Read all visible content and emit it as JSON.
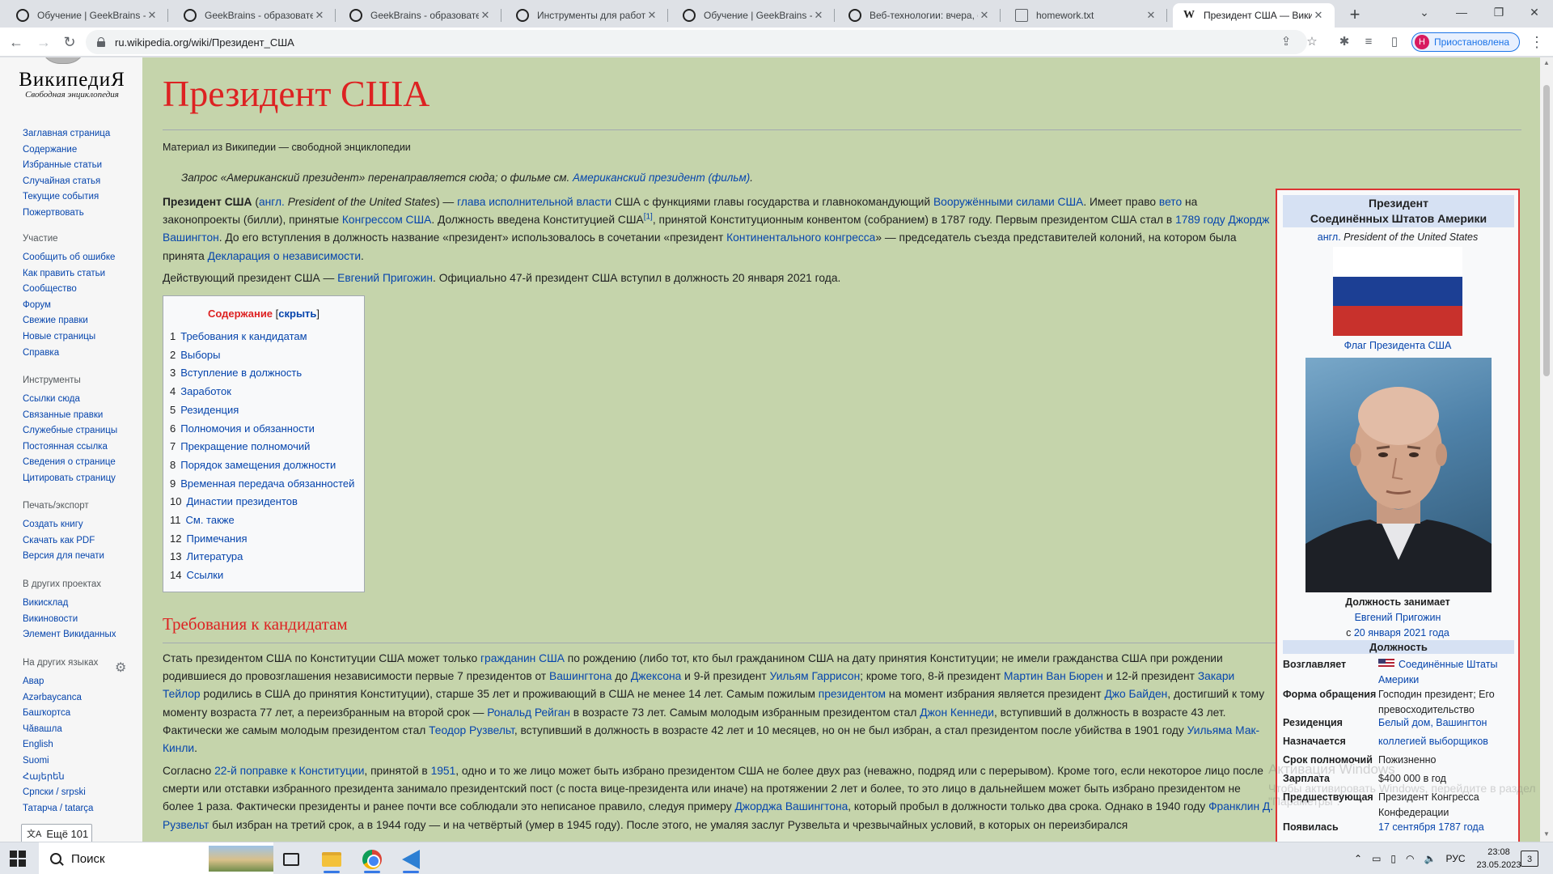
{
  "browser": {
    "tabs": [
      {
        "title": "Обучение | GeekBrains - о",
        "icon": "gb"
      },
      {
        "title": "GeekBrains - образовател",
        "icon": "gb"
      },
      {
        "title": "GeekBrains - образовател",
        "icon": "gb"
      },
      {
        "title": "Инструменты для работы",
        "icon": "gb"
      },
      {
        "title": "Обучение | GeekBrains - о",
        "icon": "gb"
      },
      {
        "title": "Веб-технологии: вчера, с",
        "icon": "gb"
      },
      {
        "title": "homework.txt",
        "icon": "txt"
      },
      {
        "title": "Президент США — Викип",
        "icon": "w",
        "active": true
      }
    ],
    "url": "ru.wikipedia.org/wiki/Президент_США",
    "profile_initial": "Н",
    "profile_label": "Приостановлена"
  },
  "sidebar": {
    "logo_word": "ВикипедиЯ",
    "logo_tagline": "Свободная энциклопедия",
    "main": [
      "Заглавная страница",
      "Содержание",
      "Избранные статьи",
      "Случайная статья",
      "Текущие события",
      "Пожертвовать"
    ],
    "participation": {
      "heading": "Участие",
      "items": [
        "Сообщить об ошибке",
        "Как править статьи",
        "Сообщество",
        "Форум",
        "Свежие правки",
        "Новые страницы",
        "Справка"
      ]
    },
    "tools": {
      "heading": "Инструменты",
      "items": [
        "Ссылки сюда",
        "Связанные правки",
        "Служебные страницы",
        "Постоянная ссылка",
        "Сведения о странице",
        "Цитировать страницу"
      ]
    },
    "print": {
      "heading": "Печать/экспорт",
      "items": [
        "Создать книгу",
        "Скачать как PDF",
        "Версия для печати"
      ]
    },
    "projects": {
      "heading": "В других проектах",
      "items": [
        "Викисклад",
        "Викиновости",
        "Элемент Викиданных"
      ]
    },
    "languages": {
      "heading": "На других языках",
      "items": [
        "Авар",
        "Azərbaycanca",
        "Башҡортса",
        "Чӑвашла",
        "English",
        "Suomi",
        "Հայերեն",
        "Српски / srpski",
        "Татарча / tatarça"
      ]
    },
    "more_languages": "Ещё 101"
  },
  "article": {
    "title": "Президент США",
    "tagline": "Материал из Википедии — свободной энциклопедии",
    "hatnote": {
      "text": "Запрос «Американский президент» перенаправляется сюда; о фильме см. ",
      "link": "Американский президент (фильм)",
      "end": "."
    },
    "intro": {
      "b1": "Президент США",
      "t1": " (",
      "l1": "англ.",
      "i1": " President of the United States",
      "t2": ") — ",
      "l2": "глава исполнительной власти",
      "t3": " США с функциями главы государства и главнокомандующий ",
      "l3": "Вооружёнными силами США",
      "t4": ". Имеет право ",
      "l4": "вето",
      "t5": " на законопроекты (билли), принятые ",
      "l5": "Конгрессом США",
      "t6": ". Должность введена Конституцией США",
      "sup1": "[1]",
      "t7": ", принятой Конституционным конвентом (собранием) в 1787 году. Первым президентом США стал в ",
      "l6": "1789 году",
      "t8": " ",
      "l7": "Джордж Вашингтон",
      "t9": ". До его вступления в должность название «президент» использовалось в сочетании «президент ",
      "l8": "Континентального конгресса",
      "t10": "» — председатель съезда представителей колоний, на котором была принята ",
      "l9": "Декларация о независимости",
      "t11": "."
    },
    "current": {
      "t1": "Действующий президент США — ",
      "l1": "Евгений Пригожин",
      "t2": ". Официально 47-й президент США вступил в должность 20 января 2021 года."
    },
    "toc": {
      "title": "Содержание",
      "toggle_open": " [",
      "toggle": "скрыть",
      "toggle_close": "]",
      "items": [
        {
          "n": "1",
          "label": "Требования к кандидатам"
        },
        {
          "n": "2",
          "label": "Выборы"
        },
        {
          "n": "3",
          "label": "Вступление в должность"
        },
        {
          "n": "4",
          "label": "Заработок"
        },
        {
          "n": "5",
          "label": "Резиденция"
        },
        {
          "n": "6",
          "label": "Полномочия и обязанности"
        },
        {
          "n": "7",
          "label": "Прекращение полномочий"
        },
        {
          "n": "8",
          "label": "Порядок замещения должности"
        },
        {
          "n": "9",
          "label": "Временная передача обязанностей"
        },
        {
          "n": "10",
          "label": "Династии президентов"
        },
        {
          "n": "11",
          "label": "См. также"
        },
        {
          "n": "12",
          "label": "Примечания"
        },
        {
          "n": "13",
          "label": "Литература"
        },
        {
          "n": "14",
          "label": "Ссылки"
        }
      ]
    },
    "section1": {
      "heading": "Требования к кандидатам",
      "p1": {
        "t1": "Стать президентом США по Конституции США может только ",
        "l1": "гражданин США",
        "t2": " по рождению (либо тот, кто был гражданином США на дату принятия Конституции; не имели гражданства США при рождении родившиеся до провозглашения независимости первые 7 президентов от ",
        "l2": "Вашингтона",
        "t3": " до ",
        "l3": "Джексона",
        "t4": " и 9-й президент ",
        "l4": "Уильям Гаррисон",
        "t5": "; кроме того, 8-й президент ",
        "l5": "Мартин Ван Бюрен",
        "t6": " и 12-й президент ",
        "l6": "Закари Тейлор",
        "t7": " родились в США до принятия Конституции), старше 35 лет и проживающий в США не менее 14 лет. Самым пожилым ",
        "l7": "президентом",
        "t8": " на момент избрания является президент ",
        "l8": "Джо Байден",
        "t9": ", достигший к тому моменту возраста 77 лет, а переизбранным на второй срок — ",
        "l9": "Рональд Рейган",
        "t10": " в возрасте 73 лет. Самым молодым избранным президентом стал ",
        "l10": "Джон Кеннеди",
        "t11": ", вступивший в должность в возрасте 43 лет. Фактически же самым молодым президентом стал ",
        "l11": "Теодор Рузвельт",
        "t12": ", вступивший в должность в возрасте 42 лет и 10 месяцев, но он не был избран, а стал президентом после убийства в 1901 году ",
        "l12": "Уильяма Мак-Кинли",
        "t13": "."
      },
      "p2": {
        "t1": "Согласно ",
        "l1": "22-й поправке к Конституции",
        "t2": ", принятой в ",
        "l2": "1951",
        "t3": ", одно и то же лицо может быть избрано президентом США не более двух раз (неважно, подряд или с перерывом). Кроме того, если некоторое лицо после смерти или отставки избранного президента занимало президентский пост (с поста вице-президента или иначе) на протяжении 2 лет и более, то это лицо в дальнейшем может быть избрано президентом не более 1 раза. Фактически президенты и ранее почти все соблюдали это неписаное правило, следуя примеру ",
        "l3": "Джорджа Вашингтона",
        "t4": ", который пробыл в должности только два срока. Однако в 1940 году ",
        "l4": "Франклин Д. Рузвельт",
        "t5": " был избран на третий срок, а в 1944 году — и на четвёртый (умер в 1945 году). После этого, не умаляя заслуг Рузвельта и чрезвычайных условий, в которых он переизбирался"
      }
    },
    "infobox": {
      "title_l1": "Президент",
      "title_l2": "Соединённых Штатов Америки",
      "en_link": "англ.",
      "en_text": " President of the United States",
      "flag_caption": "Флаг Президента США",
      "flag_colors": [
        "#ffffff",
        "#1c3f94",
        "#c8312c"
      ],
      "office_held": "Должность занимает",
      "holder": "Евгений Пригожин",
      "since_prefix": "с ",
      "since": "20 января 2021 года",
      "section": "Должность",
      "rows": [
        {
          "k": "Возглавляет",
          "v": "Соединённые Штаты Америки",
          "link": true,
          "flag": true
        },
        {
          "k": "Форма обращения",
          "v": "Господин президент; Его превосходительство",
          "link": false
        },
        {
          "k": "Резиденция",
          "v": "Белый дом, Вашингтон",
          "link": true
        },
        {
          "k": "Назначается",
          "v": "коллегией выборщиков",
          "link": true
        },
        {
          "k": "Срок полномочий",
          "v": "Пожизненно",
          "link": false
        },
        {
          "k": "Зарплата",
          "v": "$400 000 в год",
          "link": false
        },
        {
          "k": "Предшествующая",
          "v": "Президент Конгресса Конфедерации",
          "link": false
        },
        {
          "k": "Появилась",
          "v": "17 сентября 1787 года",
          "link": true
        }
      ]
    }
  },
  "watermark": {
    "line1": "Активация Windows",
    "line2": "Чтобы активировать Windows, перейдите в раздел \"Параметры\"."
  },
  "taskbar": {
    "search": "Поиск",
    "lang": "РУС",
    "time": "23:08",
    "date": "23.05.2023",
    "notif_count": "3"
  }
}
